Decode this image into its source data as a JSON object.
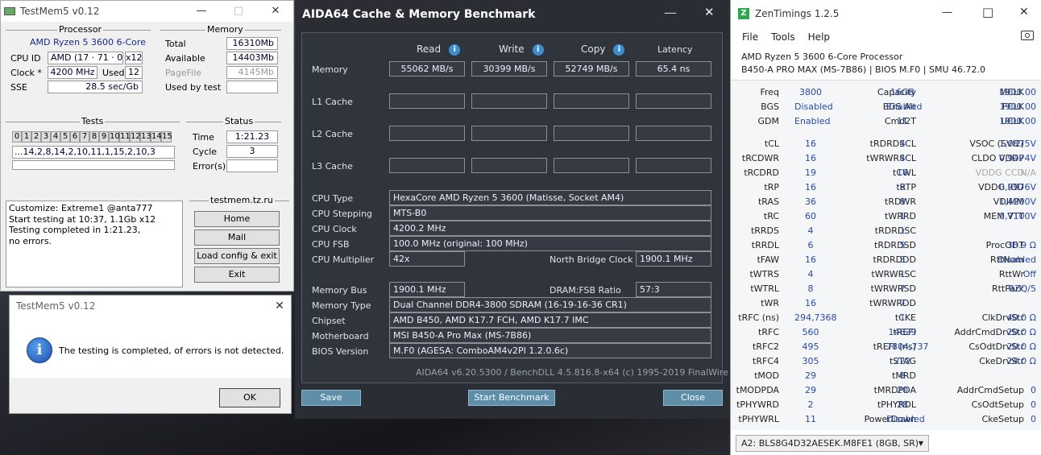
{
  "testmem": {
    "title": "TestMem5 v0.12",
    "processor_group": "Processor",
    "cpu_name": "AMD Ryzen 5 3600 6-Core",
    "cpu_id_label": "CPU ID",
    "cpu_id": "AMD  (17 · 71 · 0)",
    "cpu_threads": "x12",
    "clock_label": "Clock *",
    "clock": "4200 MHz",
    "used_label": "Used",
    "used": "12",
    "sse_label": "SSE",
    "sse": "28.5 sec/Gb",
    "memory_group": "Memory",
    "total_label": "Total",
    "total": "16310Mb",
    "available_label": "Available",
    "available": "14403Mb",
    "pagefile_label": "PageFile",
    "pagefile": "4145Mb",
    "usedbytest_label": "Used by test",
    "usedbytest": "",
    "tests_group": "Tests",
    "test_numbers": [
      "0",
      "1",
      "2",
      "3",
      "4",
      "5",
      "6",
      "7",
      "8",
      "9",
      "10",
      "11",
      "12",
      "13",
      "14",
      "15"
    ],
    "test_sequence": "...14,2,8,14,2,10,11,1,15,2,10,3",
    "status_group": "Status",
    "time_label": "Time",
    "time": "1:21.23",
    "cycle_label": "Cycle",
    "cycle": "3",
    "errors_label": "Error(s)",
    "errors": "",
    "log": [
      "Customize: Extreme1 @anta777",
      "Start testing at 10:37, 1.1Gb x12",
      "Testing completed in 1:21.23,",
      "no errors."
    ],
    "site_group": "testmem.tz.ru",
    "btn_home": "Home",
    "btn_mail": "Mail",
    "btn_load": "Load config & exit",
    "btn_exit": "Exit"
  },
  "dialog": {
    "title": "TestMem5 v0.12",
    "message": "The testing is completed, of errors is not detected.",
    "ok": "OK"
  },
  "aida": {
    "title": "AIDA64 Cache & Memory Benchmark",
    "col_read": "Read",
    "col_write": "Write",
    "col_copy": "Copy",
    "col_latency": "Latency",
    "row_memory": "Memory",
    "mem_read": "55062 MB/s",
    "mem_write": "30399 MB/s",
    "mem_copy": "52749 MB/s",
    "mem_latency": "65.4 ns",
    "row_l1": "L1 Cache",
    "row_l2": "L2 Cache",
    "row_l3": "L3 Cache",
    "info": [
      {
        "label": "CPU Type",
        "value": "HexaCore AMD Ryzen 5 3600  (Matisse, Socket AM4)"
      },
      {
        "label": "CPU Stepping",
        "value": "MTS-B0"
      },
      {
        "label": "CPU Clock",
        "value": "4200.2 MHz"
      },
      {
        "label": "CPU FSB",
        "value": "100.0 MHz  (original: 100 MHz)"
      },
      {
        "label": "CPU Multiplier",
        "value": "42x"
      }
    ],
    "nb_clock_label": "North Bridge Clock",
    "nb_clock": "1900.1 MHz",
    "membus_label": "Memory Bus",
    "membus": "1900.1 MHz",
    "dramfsb_label": "DRAM:FSB Ratio",
    "dramfsb": "57:3",
    "info2": [
      {
        "label": "Memory Type",
        "value": "Dual Channel DDR4-3800 SDRAM  (16-19-16-36 CR1)"
      },
      {
        "label": "Chipset",
        "value": "AMD B450, AMD K17.7 FCH, AMD K17.7 IMC"
      },
      {
        "label": "Motherboard",
        "value": "MSI B450-A Pro Max (MS-7B86)"
      },
      {
        "label": "BIOS Version",
        "value": "M.F0  (AGESA: ComboAM4v2PI 1.2.0.6c)"
      }
    ],
    "footer": "AIDA64 v6.20.5300 / BenchDLL 4.5.816.8-x64  (c) 1995-2019 FinalWire Ltd.",
    "btn_save": "Save",
    "btn_start": "Start Benchmark",
    "btn_close": "Close"
  },
  "zen": {
    "title": "ZenTimings 1.2.5",
    "menu": [
      "File",
      "Tools",
      "Help"
    ],
    "cpu": "AMD Ryzen 5 3600 6-Core Processor",
    "board": "B450-A PRO MAX (MS-7B86) | BIOS M.F0 | SMU 46.72.0",
    "top": [
      [
        "Freq",
        "3800",
        "Capacity",
        "16GB",
        "MCLK",
        "1900.00"
      ],
      [
        "BGS",
        "Disabled",
        "BGS Alt",
        "Enabled",
        "FCLK",
        "1900.00"
      ],
      [
        "GDM",
        "Enabled",
        "Cmd2T",
        "1T",
        "UCLK",
        "1900.00"
      ]
    ],
    "rows": [
      [
        "tCL",
        "16",
        "tRDRDSCL",
        "4",
        "VSOC (SVI2)",
        "1,0875V"
      ],
      [
        "tRCDWR",
        "16",
        "tWRWRSCL",
        "4",
        "CLDO VDDP",
        "0,9474V"
      ],
      [
        "tRCDRD",
        "19",
        "tCWL",
        "16",
        "VDDG CCD",
        "N/A"
      ],
      [
        "tRP",
        "16",
        "tRTP",
        "8",
        "VDDG IOD",
        "0,9976V"
      ],
      [
        "tRAS",
        "36",
        "tRDWR",
        "8",
        "VDIMM",
        "1,4200V"
      ],
      [
        "tRC",
        "60",
        "tWRRD",
        "1",
        "MEM VTT",
        "0,7100V"
      ],
      [
        "tRRDS",
        "4",
        "tRDRDSC",
        "1",
        "",
        ""
      ],
      [
        "tRRDL",
        "6",
        "tRDRDSD",
        "5",
        "ProcODT",
        "36.9 Ω"
      ],
      [
        "tFAW",
        "16",
        "tRDRDDD",
        "5",
        "RttNom",
        "Disabled"
      ],
      [
        "tWTRS",
        "4",
        "tWRWRSC",
        "1",
        "RttWr",
        "Off"
      ],
      [
        "tWTRL",
        "8",
        "tWRWRSD",
        "7",
        "RttPark",
        "RZQ/5"
      ],
      [
        "tWR",
        "16",
        "tWRWRDD",
        "7",
        "",
        ""
      ],
      [
        "tRFC (ns)",
        "294,7368",
        "tCKE",
        "1",
        "ClkDrvStr",
        "40.0 Ω"
      ],
      [
        "tRFC",
        "560",
        "tREFI",
        "14829",
        "AddrCmdDrvStr",
        "20.0 Ω"
      ],
      [
        "tRFC2",
        "495",
        "tREFI (ns)",
        "7804,737",
        "CsOdtDrvStr",
        "20.0 Ω"
      ],
      [
        "tRFC4",
        "305",
        "tSTAG",
        "222",
        "CkeDrvStr",
        "24.0 Ω"
      ],
      [
        "tMOD",
        "29",
        "tMRD",
        "8",
        "",
        ""
      ],
      [
        "tMODPDA",
        "29",
        "tMRDPDA",
        "20",
        "AddrCmdSetup",
        "0"
      ],
      [
        "tPHYWRD",
        "2",
        "tPHYRDL",
        "28",
        "CsOdtSetup",
        "0"
      ],
      [
        "tPHYWRL",
        "11",
        "PowerDown",
        "Disabled",
        "CkeSetup",
        "0"
      ]
    ],
    "dimm_select": "A2: BLS8G4D32AESEK.M8FE1 (8GB, SR)"
  }
}
